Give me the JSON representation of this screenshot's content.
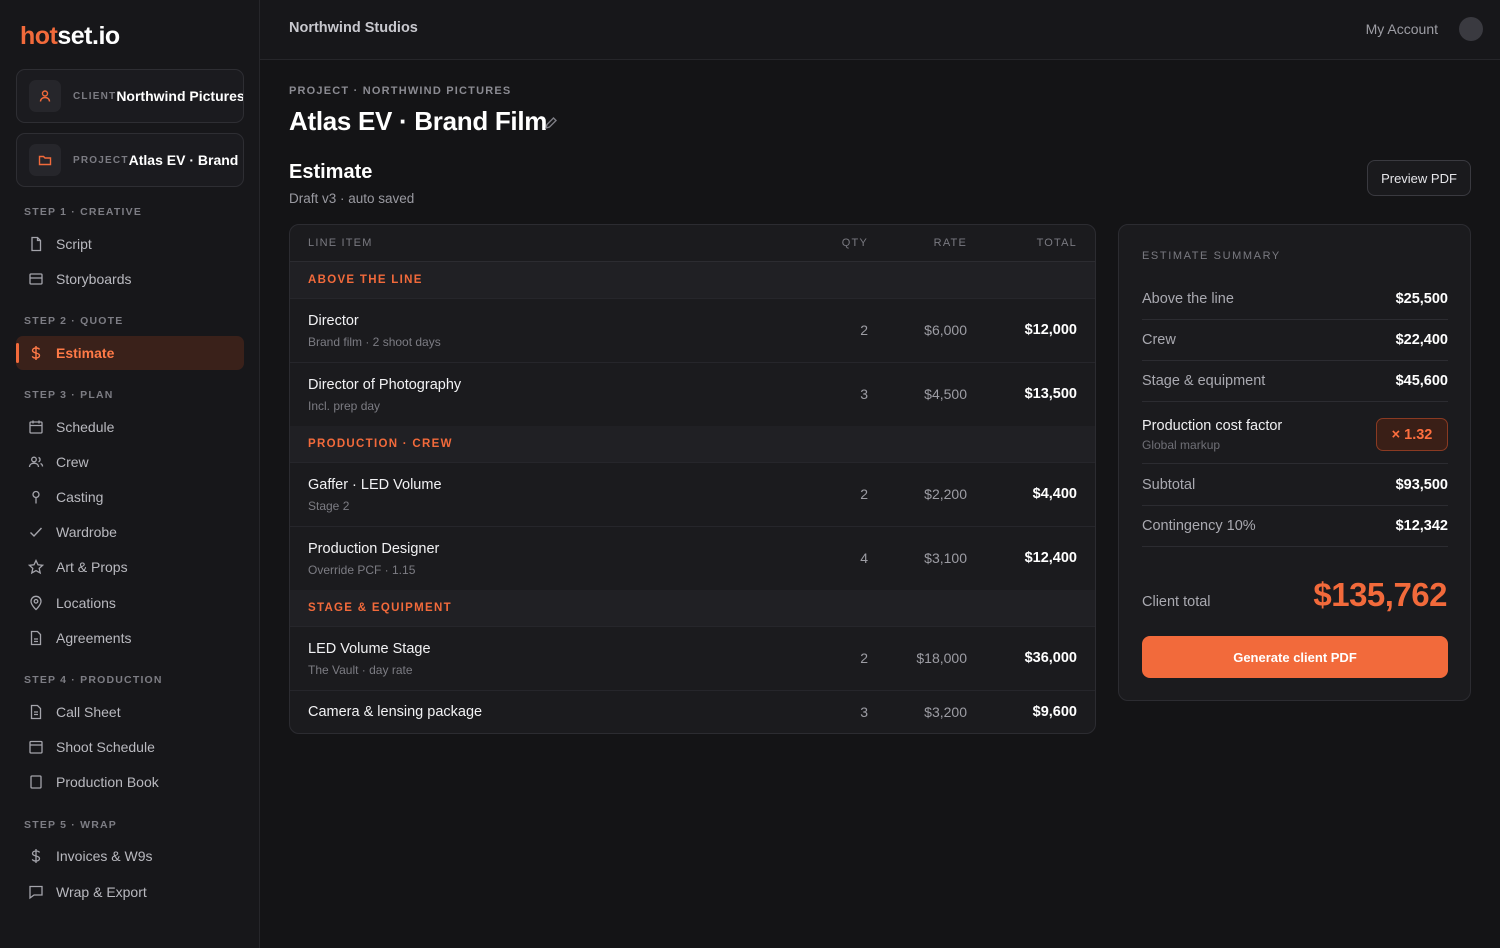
{
  "brand": {
    "logo_hot": "hot",
    "logo_rest": "set.io",
    "accent": "#f26a3b"
  },
  "context": {
    "client": {
      "label": "CLIENT",
      "value": "Northwind Pictures"
    },
    "project": {
      "label": "PROJECT",
      "value": "Atlas EV · Brand Film"
    }
  },
  "nav": {
    "step1": "STEP 1 · CREATIVE",
    "script": "Script",
    "storyboards": "Storyboards",
    "step2": "STEP 2 · QUOTE",
    "estimate": "Estimate",
    "step3": "STEP 3 · PLAN",
    "schedule": "Schedule",
    "crew": "Crew",
    "casting": "Casting",
    "wardrobe": "Wardrobe",
    "art_props": "Art & Props",
    "locations": "Locations",
    "agreements": "Agreements",
    "step4": "STEP 4 · PRODUCTION",
    "call_sheet": "Call Sheet",
    "shoot_schedule": "Shoot Schedule",
    "production_book": "Production Book",
    "step5": "STEP 5 · WRAP",
    "invoices": "Invoices & W9s",
    "wrap_export": "Wrap & Export"
  },
  "topbar": {
    "studio": "Northwind Studios",
    "account": "My Account"
  },
  "page": {
    "breadcrumb": "PROJECT · NORTHWIND PICTURES",
    "title": "Atlas EV · Brand Film",
    "section_title": "Estimate",
    "section_sub": "Draft v3 · auto saved",
    "preview_btn": "Preview PDF"
  },
  "table": {
    "headers": {
      "item": "LINE ITEM",
      "qty": "QTY",
      "rate": "RATE",
      "total": "TOTAL"
    },
    "groups": {
      "atl": "ABOVE THE LINE",
      "crew": "PRODUCTION · CREW",
      "stage": "STAGE & EQUIPMENT"
    },
    "rows": [
      {
        "name": "Director",
        "sub": "Brand film · 2 shoot days",
        "qty": "2",
        "rate": "$6,000",
        "total": "$12,000"
      },
      {
        "name": "Director of Photography",
        "sub": "Incl. prep day",
        "qty": "3",
        "rate": "$4,500",
        "total": "$13,500"
      },
      {
        "name": "Gaffer · LED Volume",
        "sub": "Stage 2",
        "qty": "2",
        "rate": "$2,200",
        "total": "$4,400"
      },
      {
        "name": "Production Designer",
        "sub": "Override PCF · 1.15",
        "qty": "4",
        "rate": "$3,100",
        "total": "$12,400"
      },
      {
        "name": "LED Volume Stage",
        "sub": "The Vault · day rate",
        "qty": "2",
        "rate": "$18,000",
        "total": "$36,000"
      },
      {
        "name": "Camera & lensing package",
        "qty": "3",
        "rate": "$3,200",
        "total": "$9,600"
      }
    ]
  },
  "summary": {
    "heading": "ESTIMATE SUMMARY",
    "above_line": {
      "label": "Above the line",
      "value": "$25,500"
    },
    "crew": {
      "label": "Crew",
      "value": "$22,400"
    },
    "stage": {
      "label": "Stage & equipment",
      "value": "$45,600"
    },
    "pcf": {
      "label": "Production cost factor",
      "sub": "Global markup",
      "value": "× 1.32"
    },
    "subtotal": {
      "label": "Subtotal",
      "value": "$93,500"
    },
    "contingency": {
      "label": "Contingency 10%",
      "value": "$12,342"
    },
    "client_total": {
      "label": "Client total",
      "value": "$135,762"
    },
    "generate_btn": "Generate client PDF"
  }
}
